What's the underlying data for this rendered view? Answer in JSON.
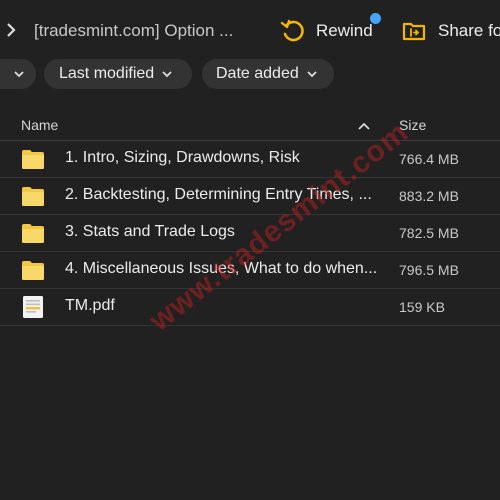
{
  "breadcrumb": {
    "title": "[tradesmint.com] Option ..."
  },
  "toolbar": {
    "rewind_label": "Rewind",
    "share_label": "Share fo"
  },
  "filters": [
    {
      "label": ""
    },
    {
      "label": "Last modified"
    },
    {
      "label": "Date added"
    }
  ],
  "columns": {
    "name": "Name",
    "size": "Size"
  },
  "files": [
    {
      "name": "1. Intro, Sizing, Drawdowns, Risk",
      "size": "766.4 MB",
      "icon": "folder-icon"
    },
    {
      "name": "2. Backtesting, Determining Entry Times, ...",
      "size": "883.2 MB",
      "icon": "folder-icon"
    },
    {
      "name": "3. Stats and Trade Logs",
      "size": "782.5 MB",
      "icon": "folder-icon"
    },
    {
      "name": "4. Miscellaneous Issues, What to do when...",
      "size": "796.5 MB",
      "icon": "folder-icon"
    },
    {
      "name": "TM.pdf",
      "size": "159 KB",
      "icon": "pdf-file-icon"
    }
  ],
  "watermark": "www.tradesmint.com",
  "colors": {
    "background": "#212121",
    "folder": "#f5c842",
    "rewind_accent": "#f5b400",
    "notification_dot": "#4aa3ff",
    "watermark": "#c81e1e"
  }
}
